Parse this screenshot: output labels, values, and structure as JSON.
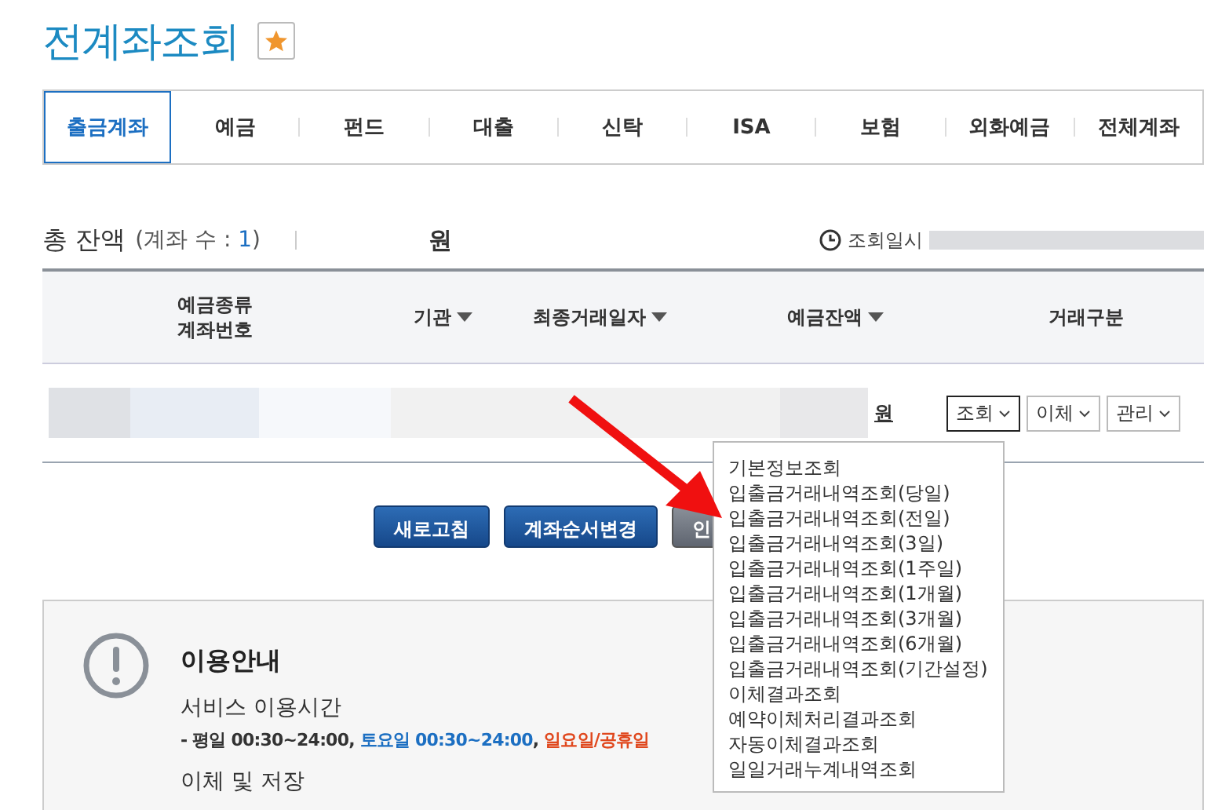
{
  "title": "전계좌조회",
  "tabs": [
    {
      "label": "출금계좌",
      "selected": true
    },
    {
      "label": "예금",
      "selected": false
    },
    {
      "label": "펀드",
      "selected": false
    },
    {
      "label": "대출",
      "selected": false
    },
    {
      "label": "신탁",
      "selected": false
    },
    {
      "label": "ISA",
      "selected": false
    },
    {
      "label": "보험",
      "selected": false
    },
    {
      "label": "외화예금",
      "selected": false
    },
    {
      "label": "전체계좌",
      "selected": false
    }
  ],
  "summary": {
    "label": "총 잔액",
    "count_prefix": "(계좌 수 : ",
    "count": "1",
    "count_suffix": ")",
    "currency": "원",
    "time_label": "조회일시"
  },
  "table": {
    "columns": [
      {
        "label": "예금종류\n계좌번호",
        "sortable": false
      },
      {
        "label": "기관",
        "sortable": true
      },
      {
        "label": "최종거래일자",
        "sortable": true
      },
      {
        "label": "예금잔액",
        "sortable": true
      },
      {
        "label": "거래구분",
        "sortable": false
      }
    ],
    "row": {
      "currency": "원",
      "actions": [
        {
          "label": "조회",
          "open": true
        },
        {
          "label": "이체",
          "open": false
        },
        {
          "label": "관리",
          "open": false
        }
      ]
    }
  },
  "buttons": [
    {
      "label": "새로고침",
      "kind": "primary"
    },
    {
      "label": "계좌순서변경",
      "kind": "primary"
    },
    {
      "label": "인",
      "kind": "secondary"
    }
  ],
  "menu": [
    "기본정보조회",
    "입출금거래내역조회(당일)",
    "입출금거래내역조회(전일)",
    "입출금거래내역조회(3일)",
    "입출금거래내역조회(1주일)",
    "입출금거래내역조회(1개월)",
    "입출금거래내역조회(3개월)",
    "입출금거래내역조회(6개월)",
    "입출금거래내역조회(기간설정)",
    "이체결과조회",
    "예약이체처리결과조회",
    "자동이체결과조회",
    "일일거래누계내역조회"
  ],
  "notice": {
    "title": "이용안내",
    "sections": [
      {
        "heading": "서비스 이용시간",
        "parts": [
          {
            "text": "- 평일 00:30~24:00, "
          },
          {
            "text": "토요일 00:30~24:00",
            "color": "#1c6fc2"
          },
          {
            "text": ", "
          },
          {
            "text": "일요일/공휴일",
            "color": "#e0481e"
          }
        ]
      },
      {
        "heading": "이체 및 저장"
      }
    ]
  }
}
